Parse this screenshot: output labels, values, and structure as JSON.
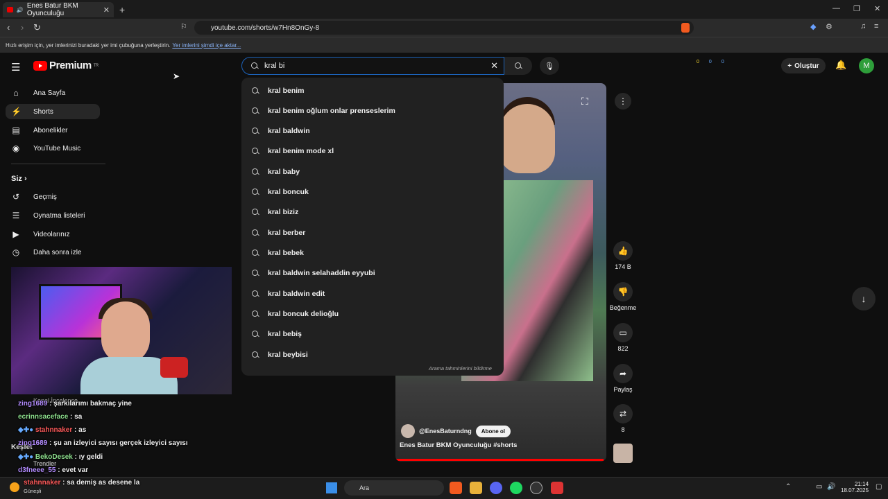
{
  "browser": {
    "tab_title": "Enes Batur BKM Oyunculuğu",
    "url": "youtube.com/shorts/w7Hn8OnGy-8",
    "bookmarks_hint": "Hızlı erişim için, yer imlerinizi buradaki yer imi çubuğuna yerleştirin.",
    "bookmarks_link": "Yer imlerini şimdi içe aktar..."
  },
  "youtube": {
    "logo_text": "Premium",
    "logo_region": "TR",
    "search_value": "kral bi",
    "create_label": "Oluştur",
    "avatar_letter": "M",
    "ext_stats": [
      "0",
      "0",
      "0"
    ]
  },
  "sidebar": {
    "items": [
      {
        "label": "Ana Sayfa",
        "icon": "home-icon"
      },
      {
        "label": "Shorts",
        "icon": "shorts-icon"
      },
      {
        "label": "Abonelikler",
        "icon": "subscriptions-icon"
      },
      {
        "label": "YouTube Music",
        "icon": "music-icon"
      }
    ],
    "you_heading": "Siz",
    "you_items": [
      {
        "label": "Geçmiş",
        "icon": "history-icon"
      },
      {
        "label": "Oynatma listeleri",
        "icon": "playlists-icon"
      },
      {
        "label": "Videolarınız",
        "icon": "your-videos-icon"
      },
      {
        "label": "Daha sonra izle",
        "icon": "watch-later-icon"
      }
    ],
    "explore_heading": "Keşfet",
    "trending_label": "Trendler"
  },
  "suggestions": [
    "kral benim",
    "kral benim oğlum onlar prenseslerim",
    "kral baldwin",
    "kral benim mode xl",
    "kral baby",
    "kral boncuk",
    "kral biziz",
    "kral berber",
    "kral bebek",
    "kral baldwin selahaddin eyyubi",
    "kral baldwin edit",
    "kral boncuk delioğlu",
    "kral bebiş",
    "kral beybisi"
  ],
  "report_text": "Arama tahminlerini bildirme",
  "short": {
    "channel": "@EnesBaturndng",
    "subscribe_label": "Abone ol",
    "title": "Enes Batur BKM Oyunculuğu #shorts",
    "likes": "174 B",
    "dislike_label": "Beğenme",
    "comments": "822",
    "share_label": "Paylaş",
    "remix": "8"
  },
  "chat": [
    {
      "user": "zing1689",
      "msg": " : şarkılarımı bakmaç yine"
    },
    {
      "user": "ecrinnsaceface",
      "msg": " : sa"
    },
    {
      "user": "stahnnaker",
      "msg": " : as"
    },
    {
      "user": "zing1689",
      "msg": " : şu an izleyici sayısı gerçek izleyici sayısı"
    },
    {
      "user": "BekoDesek",
      "msg": " : ıy geldi"
    },
    {
      "user": "d3fneee_55",
      "msg": " : evet var"
    },
    {
      "user": "stahnnaker",
      "msg": " : sa demiş as desene la"
    }
  ],
  "chat_hidden_label": "Kanal İncelense",
  "taskbar": {
    "search_label": "Ara",
    "weather": "Güneşli",
    "time": "21:14",
    "date": "18.07.2025"
  },
  "colors": {
    "accent": "#ff0000",
    "search_border": "#1c62b9"
  }
}
